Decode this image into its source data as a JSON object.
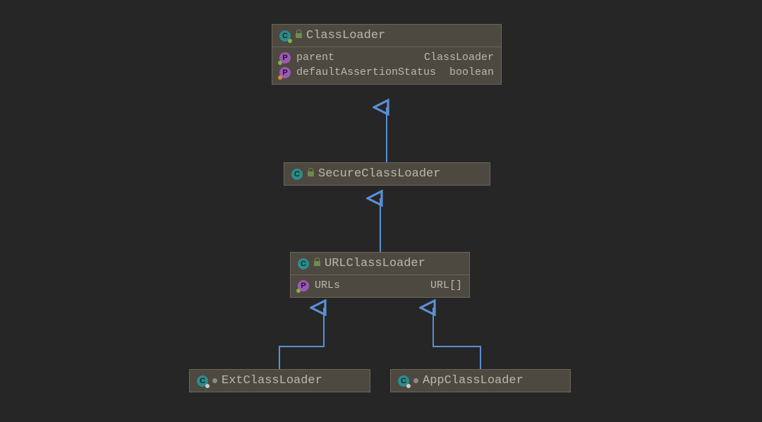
{
  "classes": {
    "classloader": {
      "name": "ClassLoader",
      "fields": [
        {
          "name": "parent",
          "type": "ClassLoader",
          "marker": "green"
        },
        {
          "name": "defaultAssertionStatus",
          "type": "boolean",
          "marker": "orange"
        }
      ]
    },
    "secure": {
      "name": "SecureClassLoader"
    },
    "url": {
      "name": "URLClassLoader",
      "fields": [
        {
          "name": "URLs",
          "type": "URL[]",
          "marker": "green"
        }
      ]
    },
    "ext": {
      "name": "ExtClassLoader"
    },
    "app": {
      "name": "AppClassLoader"
    }
  }
}
